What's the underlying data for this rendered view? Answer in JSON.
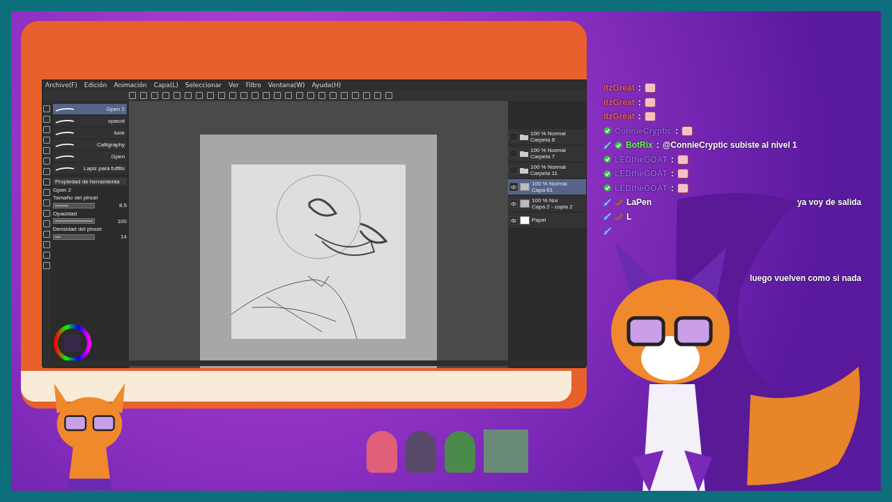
{
  "app": {
    "menu": [
      "Archivo(F)",
      "Edición",
      "Animación",
      "Capa(L)",
      "Seleccionar",
      "Ver",
      "Filtro",
      "Ventana(W)",
      "Ayuda(H)"
    ],
    "brushes": [
      {
        "name": "Gpen 2",
        "selected": true
      },
      {
        "name": "opacot",
        "selected": false
      },
      {
        "name": "lune",
        "selected": false
      },
      {
        "name": "Calligraphy",
        "selected": false
      },
      {
        "name": "Gpen",
        "selected": false
      },
      {
        "name": "Lapiz para fuffito",
        "selected": false
      }
    ],
    "tool_property": {
      "title": "Propiedad de herramienta",
      "brush": "Gpen 2",
      "settings": [
        {
          "label": "Tamaño del pincel",
          "value": "8.5",
          "level": 0.35
        },
        {
          "label": "Opacidad",
          "value": "100",
          "level": 1
        },
        {
          "label": "Densidad del pincel",
          "value": "14",
          "level": 0.14
        }
      ]
    },
    "layers": [
      {
        "mode": "100 % Normal",
        "name": "Carpeta 8",
        "kind": "folder",
        "visible": false,
        "selected": false
      },
      {
        "mode": "100 % Normal",
        "name": "Carpeta 7",
        "kind": "folder",
        "visible": false,
        "selected": false
      },
      {
        "mode": "100 % Normal",
        "name": "Carpeta 11",
        "kind": "folder",
        "visible": false,
        "selected": false
      },
      {
        "mode": "100 % Normal",
        "name": "Capa 61",
        "kind": "raster",
        "visible": true,
        "selected": true
      },
      {
        "mode": "100 % Nor",
        "name": "Capa 2 - copia 2",
        "kind": "raster",
        "visible": true,
        "selected": false
      },
      {
        "name": "Papel",
        "kind": "paper",
        "visible": true,
        "selected": false
      }
    ]
  },
  "chat": [
    {
      "user": "itzGreat",
      "color": "#e2606c",
      "separator": ":",
      "emote": true
    },
    {
      "user": "itzGreat",
      "color": "#e2606c",
      "separator": ":",
      "emote": true
    },
    {
      "user": "itzGreat",
      "color": "#e2606c",
      "separator": ":",
      "emote": true
    },
    {
      "user": "ConnieCryptic",
      "color": "#9a5cf0",
      "badges": [
        {
          "kind": "check"
        }
      ],
      "separator": ":",
      "emote": true
    },
    {
      "user": "BotRix",
      "color": "#6cff4c",
      "badges": [
        {
          "kind": "sword"
        },
        {
          "kind": "check"
        }
      ],
      "separator": ":",
      "text": "@ConnieCryptic subiste al nivel 1",
      "emote": false
    },
    {
      "user": "LEDtheGOAT",
      "color": "#9a5cf0",
      "badges": [
        {
          "kind": "check"
        }
      ],
      "separator": ":",
      "emote": true
    },
    {
      "user": "LEDtheGOAT",
      "color": "#9a5cf0",
      "badges": [
        {
          "kind": "check"
        }
      ],
      "separator": ":",
      "emote": true
    },
    {
      "user": "LEDtheGOAT",
      "color": "#9a5cf0",
      "badges": [
        {
          "kind": "check"
        }
      ],
      "separator": ":",
      "emote": true
    },
    {
      "user": "LaPen",
      "color": "#ffffff",
      "badges": [
        {
          "kind": "sword"
        },
        {
          "kind": "bits"
        }
      ],
      "text": "ya voy de salida",
      "emote": false
    },
    {
      "user": "L",
      "color": "#ffffff",
      "badges": [
        {
          "kind": "sword"
        },
        {
          "kind": "bits"
        }
      ],
      "emote": false
    },
    {
      "badges": [
        {
          "kind": "sword"
        }
      ],
      "emote": false
    },
    {
      "text": "luego vuelven como si nada",
      "emote": false
    }
  ]
}
